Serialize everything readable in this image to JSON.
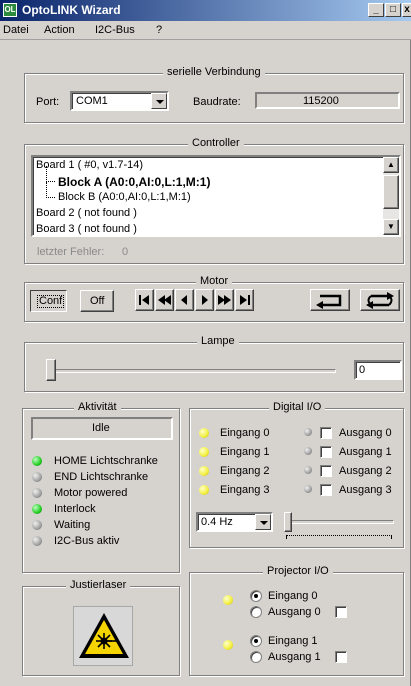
{
  "window": {
    "title": "OptoLINK Wizard",
    "app_icon": "OL",
    "minimize": "_",
    "restore": "□",
    "close": "x"
  },
  "menu": [
    "Datei",
    "Action",
    "I2C-Bus",
    "?"
  ],
  "serial": {
    "group_title": "serielle Verbindung",
    "port_label": "Port:",
    "port_value": "COM1",
    "baud_label": "Baudrate:",
    "baud_value": "115200"
  },
  "controller": {
    "group_title": "Controller",
    "tree": [
      {
        "text": "Board 1  ( #0, v1.7-14)",
        "level": 0,
        "bold": false
      },
      {
        "text": "Block A  (A0:0,AI:0,L:1,M:1)",
        "level": 1,
        "bold": true
      },
      {
        "text": "Block B  (A0:0,AI:0,L:1,M:1)",
        "level": 1,
        "bold": false
      },
      {
        "text": "Board 2  ( not found )",
        "level": 0,
        "bold": false
      },
      {
        "text": "Board 3  ( not found )",
        "level": 0,
        "bold": false
      }
    ],
    "last_error_label": "letzter Fehler:",
    "last_error_value": "0"
  },
  "motor": {
    "group_title": "Motor",
    "conf_label": "Conf",
    "off_label": "Off",
    "transport_icons": [
      "skip-back-icon",
      "fast-rewind-icon",
      "step-back-icon",
      "step-forward-icon",
      "fast-forward-icon",
      "skip-forward-icon"
    ],
    "return_icon": "return-arrow-icon",
    "loop_icon": "loop-arrows-icon"
  },
  "lamp": {
    "group_title": "Lampe",
    "value": "0",
    "slider_level": 0.0
  },
  "activity": {
    "group_title": "Aktivität",
    "status": "Idle",
    "items": [
      {
        "label": "HOME Lichtschranke",
        "led": "green"
      },
      {
        "label": "END Lichtschranke",
        "led": "gray"
      },
      {
        "label": "Motor powered",
        "led": "gray"
      },
      {
        "label": "Interlock",
        "led": "green"
      },
      {
        "label": "Waiting",
        "led": "gray"
      },
      {
        "label": "I2C-Bus aktiv",
        "led": "gray"
      }
    ]
  },
  "digital_io": {
    "group_title": "Digital I/O",
    "inputs": [
      "Eingang 0",
      "Eingang 1",
      "Eingang 2",
      "Eingang 3"
    ],
    "outputs": [
      "Ausgang 0",
      "Ausgang 1",
      "Ausgang 2",
      "Ausgang 3"
    ],
    "frequency": "0.4 Hz",
    "slider_level": 0.0
  },
  "laser": {
    "group_title": "Justierlaser",
    "icon": "laser-warning-icon"
  },
  "projector_io": {
    "group_title": "Projector I/O",
    "channels": [
      {
        "input": "Eingang 0",
        "output": "Ausgang 0",
        "selected": "input"
      },
      {
        "input": "Eingang 1",
        "output": "Ausgang 1",
        "selected": "input"
      }
    ]
  },
  "colors": {
    "title_start": "#0a246a",
    "title_end": "#a6caf0",
    "face": "#d6d3ce",
    "led_green": "#22cc22",
    "led_yellow": "#f2ef3a"
  }
}
